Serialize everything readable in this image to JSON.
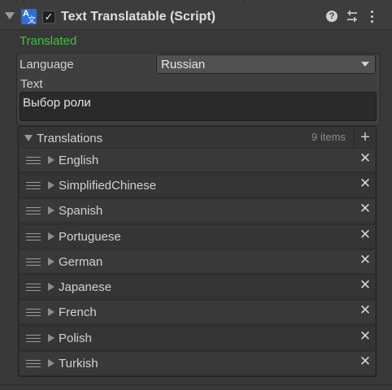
{
  "component": {
    "title": "Text Translatable (Script)",
    "enabled_glyph": "✓",
    "icon": "translate-icon",
    "icon_glyphs": {
      "primary": "A",
      "secondary": "文"
    },
    "header_icons": [
      "help-icon",
      "preset-icon",
      "menu-icon"
    ]
  },
  "status": "Translated",
  "fields": {
    "language_label": "Language",
    "language_value": "Russian",
    "text_label": "Text",
    "text_value": "Выбор роли"
  },
  "translations": {
    "title": "Translations",
    "count": "9 items",
    "add_glyph": "+",
    "remove_glyph": "✕",
    "items": [
      {
        "label": "English"
      },
      {
        "label": "SimplifiedChinese"
      },
      {
        "label": "Spanish"
      },
      {
        "label": "Portuguese"
      },
      {
        "label": "German"
      },
      {
        "label": "Japanese"
      },
      {
        "label": "French"
      },
      {
        "label": "Polish"
      },
      {
        "label": "Turkish"
      }
    ]
  },
  "colors": {
    "background": "#383838",
    "status_green": "#3fc23f",
    "icon_blue": "#2d6fd6",
    "row_light": "#393939",
    "row_dark": "#353535"
  }
}
